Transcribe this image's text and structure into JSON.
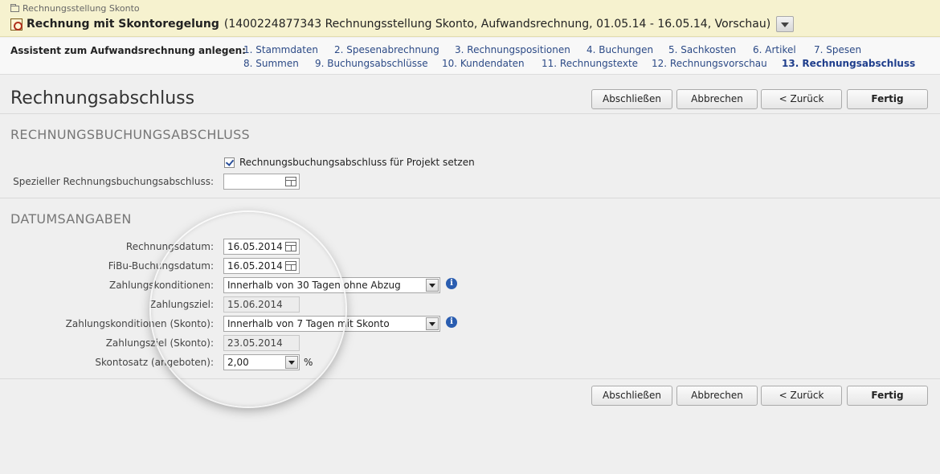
{
  "header": {
    "breadcrumb": "Rechnungsstellung Skonto",
    "title_bold": "Rechnung mit Skontoregelung",
    "title_detail": "(1400224877343 Rechnungsstellung Skonto, Aufwandsrechnung, 01.05.14 - 16.05.14, Vorschau)"
  },
  "wizard": {
    "label": "Assistent zum Aufwandsrechnung anlegen:",
    "steps": [
      "1. Stammdaten",
      "2. Spesenabrechnung",
      "3. Rechnungspositionen",
      "4. Buchungen",
      "5. Sachkosten",
      "6. Artikel",
      "7. Spesen",
      "8. Summen",
      "9. Buchungsabschlüsse",
      "10. Kundendaten",
      "11. Rechnungstexte",
      "12. Rechnungsvorschau",
      "13. Rechnungsabschluss"
    ]
  },
  "page": {
    "title": "Rechnungsabschluss"
  },
  "buttons": {
    "finish_close": "Abschließen",
    "cancel": "Abbrechen",
    "back": "< Zurück",
    "done": "Fertig"
  },
  "section1": {
    "title": "RECHNUNGSBUCHUNGSABSCHLUSS",
    "checkbox_label": "Rechnungsbuchungsabschluss für Projekt setzen",
    "special_label": "Spezieller Rechnungsbuchungsabschluss:",
    "special_value": ""
  },
  "section2": {
    "title": "DATUMSANGABEN",
    "fields": [
      {
        "label": "Rechnungsdatum:",
        "value": "16.05.2014"
      },
      {
        "label": "FiBu-Buchungsdatum:",
        "value": "16.05.2014"
      },
      {
        "label": "Zahlungskonditionen:",
        "value": "Innerhalb von 30 Tagen ohne Abzug"
      },
      {
        "label": "Zahlungsziel:",
        "value": "15.06.2014"
      },
      {
        "label": "Zahlungskonditionen (Skonto):",
        "value": "Innerhalb von 7 Tagen mit Skonto"
      },
      {
        "label": "Zahlungsziel (Skonto):",
        "value": "23.05.2014"
      },
      {
        "label": "Skontosatz (angeboten):",
        "value": "2,00",
        "unit": "%"
      }
    ]
  },
  "icons": {
    "info": "i"
  }
}
